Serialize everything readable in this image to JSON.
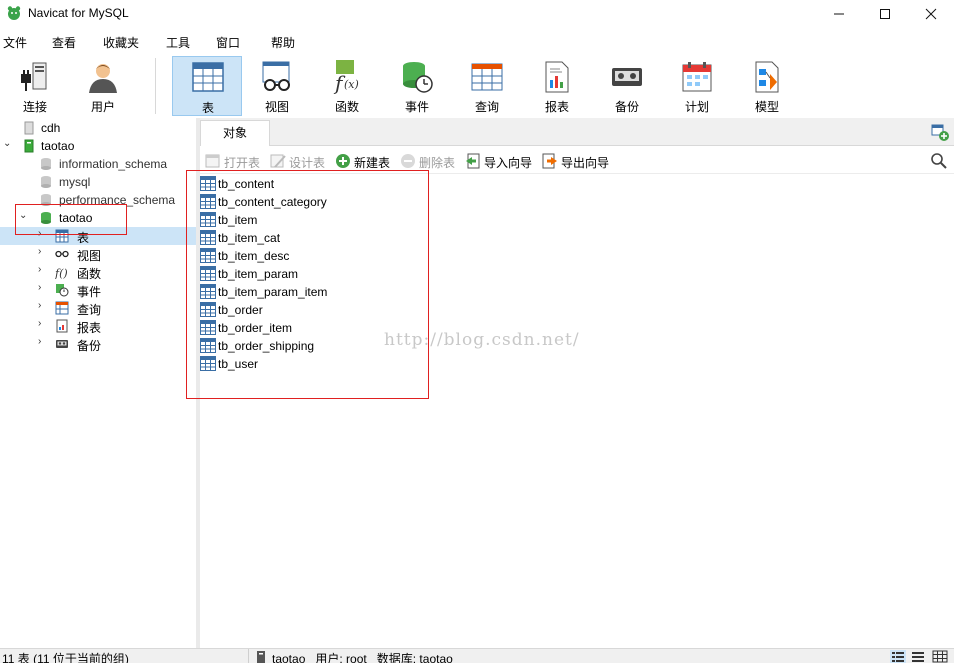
{
  "window": {
    "title": "Navicat for MySQL"
  },
  "menu": [
    "文件",
    "查看",
    "收藏夹",
    "工具",
    "窗口",
    "帮助"
  ],
  "toolbar": [
    {
      "label": "连接",
      "icon": "connection-icon"
    },
    {
      "label": "用户",
      "icon": "user-icon"
    },
    {
      "label": "表",
      "icon": "table-icon",
      "active": true
    },
    {
      "label": "视图",
      "icon": "view-icon"
    },
    {
      "label": "函数",
      "icon": "function-icon"
    },
    {
      "label": "事件",
      "icon": "event-icon"
    },
    {
      "label": "查询",
      "icon": "query-icon"
    },
    {
      "label": "报表",
      "icon": "report-icon"
    },
    {
      "label": "备份",
      "icon": "backup-icon"
    },
    {
      "label": "计划",
      "icon": "schedule-icon"
    },
    {
      "label": "模型",
      "icon": "model-icon"
    }
  ],
  "sidebar": {
    "connections": [
      {
        "label": "cdh"
      },
      {
        "label": "taotao"
      }
    ],
    "databases": [
      {
        "label": "information_schema"
      },
      {
        "label": "mysql"
      },
      {
        "label": "performance_schema"
      },
      {
        "label": "taotao"
      }
    ],
    "children": [
      {
        "label": "表",
        "icon": "table-icon"
      },
      {
        "label": "视图",
        "icon": "view-icon"
      },
      {
        "label": "函数",
        "icon": "function-icon"
      },
      {
        "label": "事件",
        "icon": "event-icon"
      },
      {
        "label": "查询",
        "icon": "query-icon"
      },
      {
        "label": "报表",
        "icon": "report-icon"
      },
      {
        "label": "备份",
        "icon": "backup-icon"
      }
    ]
  },
  "tabs": [
    {
      "label": "对象"
    }
  ],
  "object_toolbar": [
    {
      "label": "打开表",
      "enabled": false,
      "icon": "open-table-icon"
    },
    {
      "label": "设计表",
      "enabled": false,
      "icon": "design-table-icon"
    },
    {
      "label": "新建表",
      "enabled": true,
      "icon": "new-table-icon"
    },
    {
      "label": "删除表",
      "enabled": false,
      "icon": "delete-table-icon"
    },
    {
      "label": "导入向导",
      "enabled": true,
      "icon": "import-wizard-icon"
    },
    {
      "label": "导出向导",
      "enabled": true,
      "icon": "export-wizard-icon"
    }
  ],
  "tables": [
    "tb_content",
    "tb_content_category",
    "tb_item",
    "tb_item_cat",
    "tb_item_desc",
    "tb_item_param",
    "tb_item_param_item",
    "tb_order",
    "tb_order_item",
    "tb_order_shipping",
    "tb_user"
  ],
  "watermark": "http://blog.csdn.net/",
  "status": {
    "left": "11 表 (11 位于当前的组)",
    "connection": "taotao",
    "user": "用户: root",
    "database": "数据库: taotao"
  },
  "colors": {
    "selection": "#cce4f7",
    "highlight_box": "#e02020",
    "db_green": "#3bab3b"
  }
}
